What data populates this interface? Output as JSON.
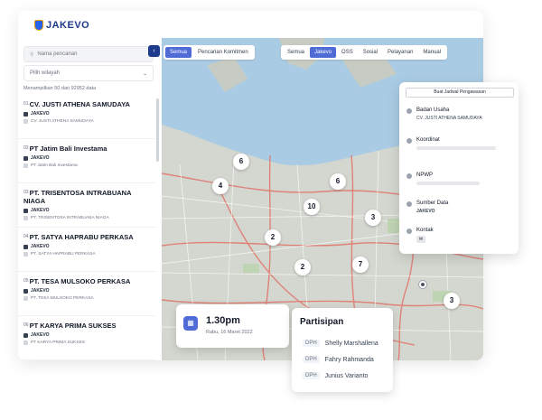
{
  "app": {
    "logo_text": "JAKEVO"
  },
  "sidebar": {
    "search_placeholder": "Nama pencarian",
    "region_select": "Pilih wilayah",
    "count_text": "Menampilkan 50 dari 92952 data",
    "items": [
      {
        "num": "01",
        "name": "CV. JUSTI ATHENA SAMUDAYA",
        "source": "JAKEVO",
        "sub": "CV. JUSTI ATHENA SAMUDAYA"
      },
      {
        "num": "02",
        "name": "PT Jatim Bali Investama",
        "source": "JAKEVO",
        "sub": "PT Jatim Bali Investama"
      },
      {
        "num": "03",
        "name": "PT. TRISENTOSA INTRABUANA NIAGA",
        "source": "JAKEVO",
        "sub": "PT. TRISENTOSA INTRABUANA NIAGA"
      },
      {
        "num": "04",
        "name": "PT. SATYA HAPRABU PERKASA",
        "source": "JAKEVO",
        "sub": "PT. SATYA HAPRABU PERKASA"
      },
      {
        "num": "05",
        "name": "PT. TESA MULSOKO PERKASA",
        "source": "JAKEVO",
        "sub": "PT. TESA MULSOKO PERKASA"
      },
      {
        "num": "06",
        "name": "PT KARYA PRIMA SUKSES",
        "source": "JAKEVO",
        "sub": "PT KARYA PRIMA SUKSES"
      }
    ]
  },
  "map": {
    "back_label": "‹",
    "filter_a": [
      "Semua",
      "Pencarian Komitmen"
    ],
    "filter_b": [
      "Semua",
      "Jakevo",
      "OSS",
      "Sosial",
      "Pelayanan",
      "Manual"
    ],
    "clusters": [
      "6",
      "4",
      "6",
      "10",
      "3",
      "2",
      "2",
      "7",
      "3"
    ]
  },
  "detail": {
    "button": "Buat Jadwal Pengawasan",
    "badan_usaha_label": "Badan Usaha",
    "badan_usaha_value": "CV. JUSTI ATHENA SAMUDAYA",
    "koordinat_label": "Koordinat",
    "npwp_label": "NPWP",
    "sumber_label": "Sumber Data",
    "sumber_value": "JAKEVO",
    "kontak_label": "Kontak"
  },
  "schedule": {
    "time": "1.30pm",
    "date": "Rabu, 16 Maret 2022"
  },
  "participants": {
    "title": "Partisipan",
    "list": [
      {
        "tag": "DPH",
        "name": "Shelly Marshallena"
      },
      {
        "tag": "DPH",
        "name": "Fahry Rahmanda"
      },
      {
        "tag": "DPH",
        "name": "Junius Varianto"
      }
    ]
  }
}
